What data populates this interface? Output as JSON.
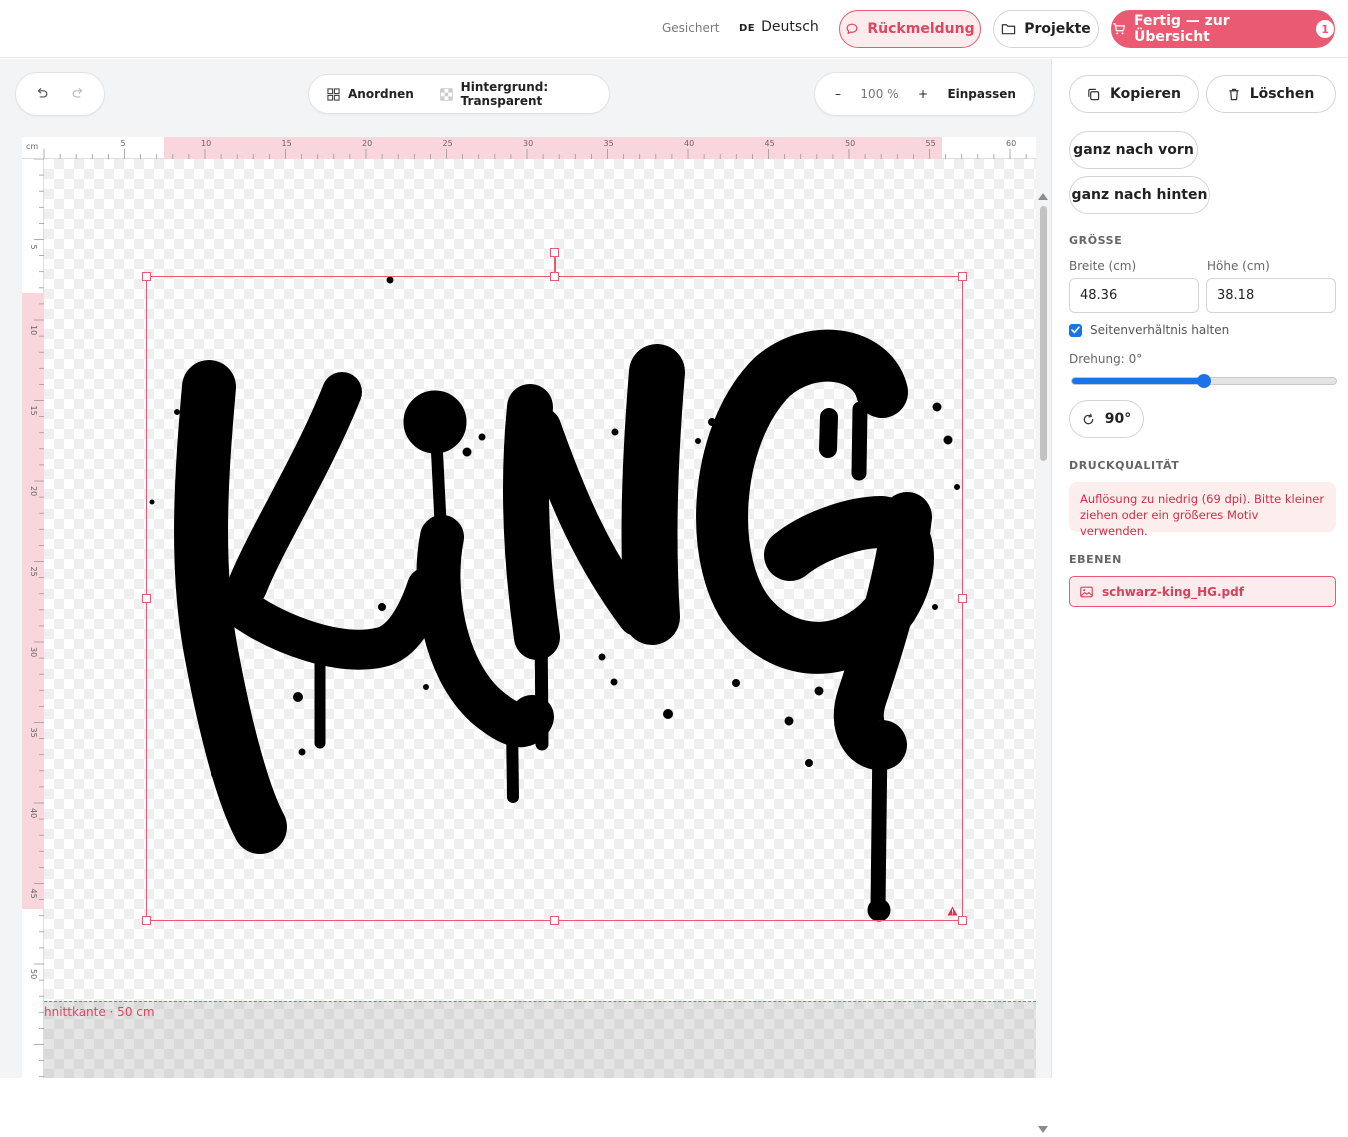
{
  "header": {
    "status": "Gesichert",
    "language_code": "DE",
    "language_name": "Deutsch",
    "feedback_label": "Rückmeldung",
    "projects_label": "Projekte",
    "done_label": "Fertig — zur Übersicht",
    "cart_count": "1"
  },
  "toolbar": {
    "arrange_label": "Anordnen",
    "background_label": "Hintergrund: Transparent",
    "zoom_out": "–",
    "zoom_value": "100 %",
    "zoom_in": "+",
    "fit_label": "Einpassen"
  },
  "canvas": {
    "ruler_unit": "cm",
    "ruler_ticks_top": [
      "5",
      "10",
      "15",
      "20",
      "25",
      "30",
      "35",
      "40",
      "45",
      "50",
      "55",
      "60"
    ],
    "ruler_ticks_left": [
      "5",
      "10",
      "15",
      "20",
      "25",
      "30",
      "35",
      "40",
      "45",
      "50"
    ],
    "cut_label": "hnittkante · 50 cm",
    "design_text": "KiNG"
  },
  "panel": {
    "copy_label": "Kopieren",
    "delete_label": "Löschen",
    "front_label": "ganz nach vorn",
    "back_label": "ganz nach hinten",
    "size_heading": "GRÖSSE",
    "width_label": "Breite (cm)",
    "width_value": "48.36",
    "height_label": "Höhe (cm)",
    "height_value": "38.18",
    "aspect_label": "Seitenverhältnis halten",
    "aspect_checked": true,
    "rotation_label": "Drehung: 0°",
    "rotation_fraction": 0.5,
    "rotate_label": "90°",
    "quality_heading": "DRUCKQUALITÄT",
    "quality_message": "Auflösung zu niedrig (69 dpi). Bitte kleiner ziehen oder ein größeres Motiv verwenden.",
    "layers_heading": "EBENEN",
    "layer_name": "schwarz-king_HG.pdf"
  },
  "colors": {
    "accent": "#ea5a72",
    "slider": "#1a73e8",
    "alert_text": "#d02f45"
  }
}
